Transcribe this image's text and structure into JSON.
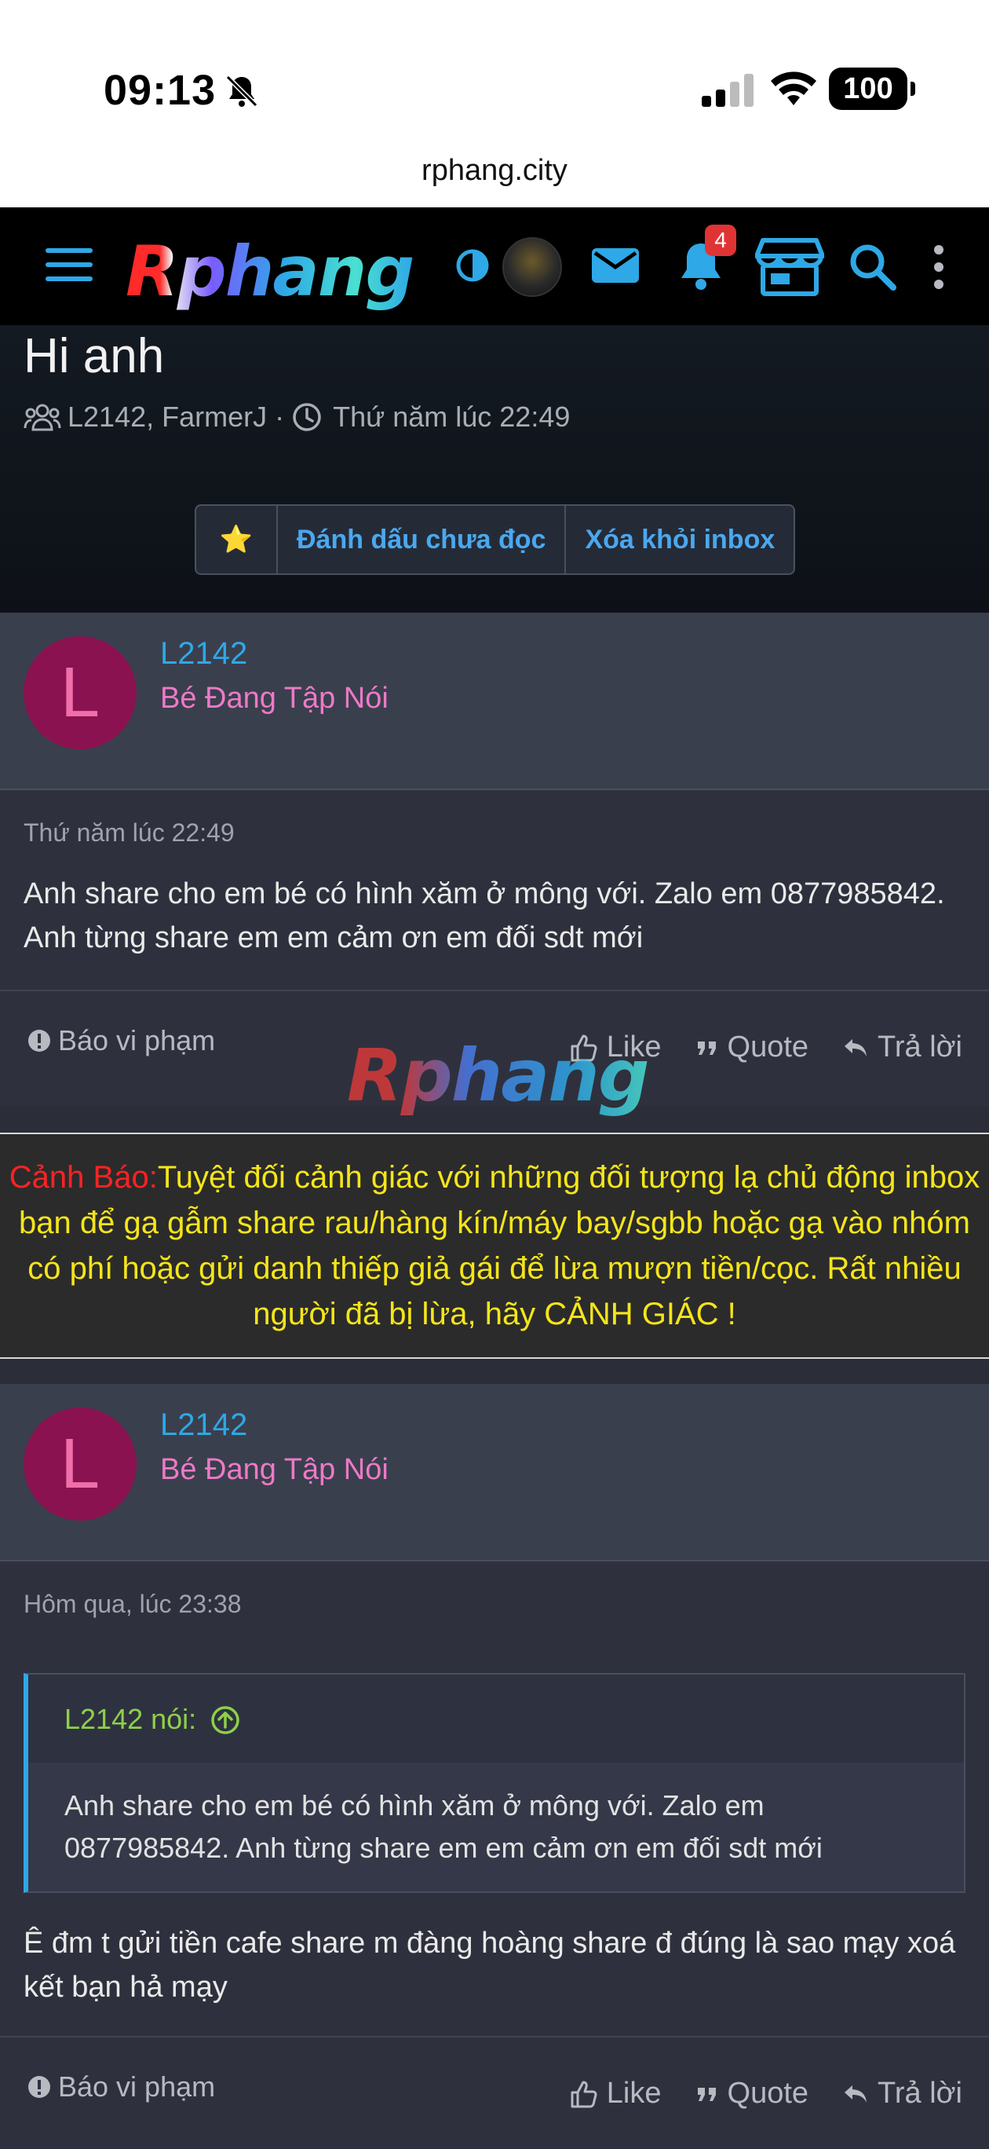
{
  "status_bar": {
    "time": "09:13",
    "battery": "100"
  },
  "browser": {
    "url": "rphang.city"
  },
  "nav": {
    "logo_text": "Rphang",
    "notification_count": "4"
  },
  "conversation": {
    "title": "Hi anh",
    "participants": "L2142, FarmerJ",
    "separator": "·",
    "time": "Thứ năm lúc 22:49",
    "actions": {
      "star": "⭐",
      "mark_unread": "Đánh dấu chưa đọc",
      "remove_inbox": "Xóa khỏi inbox"
    }
  },
  "messages": [
    {
      "avatar_letter": "L",
      "name": "L2142",
      "rank": "Bé Đang Tập Nói",
      "date": "Thứ năm lúc 22:49",
      "text": "Anh share cho em bé có hình xăm ở mông với. Zalo em 0877985842. Anh từng share em em cảm ơn em đối sdt mới",
      "report": "Báo vi phạm",
      "like": "Like",
      "quote": "Quote",
      "reply": "Trả lời"
    },
    {
      "avatar_letter": "L",
      "name": "L2142",
      "rank": "Bé Đang Tập Nói",
      "date": "Hôm qua, lúc 23:38",
      "quote_author": "L2142 nói:",
      "quote_text": "Anh share cho em bé có hình xăm ở mông với. Zalo em 0877985842. Anh từng share em em cảm ơn em đối sdt mới",
      "text": "Ê đm t gửi tiền cafe share m đàng hoàng share đ đúng là sao mạy xoá kết bạn hả mạy",
      "report": "Báo vi phạm",
      "like": "Like",
      "quote": "Quote",
      "reply": "Trả lời"
    }
  ],
  "warning": {
    "label": "Cảnh Báo:",
    "text": "Tuyệt đối cảnh giác với những đối tượng lạ chủ động inbox bạn để gạ gẫm share rau/hàng kín/máy bay/sgbb hoặc gạ vào nhóm có phí hoặc gửi danh thiếp giả gái để lừa mượn tiền/cọc. Rất nhiều người đã bị lừa, hãy CẢNH GIÁC !"
  },
  "watermark": "Rphang",
  "colors": {
    "accent": "#2ea8e6",
    "rank": "#ec7ac6",
    "avatar_bg": "#8a1250",
    "warning_label": "#ff2222",
    "warning_text": "#f5e51a",
    "quote_author": "#8ed04a"
  }
}
